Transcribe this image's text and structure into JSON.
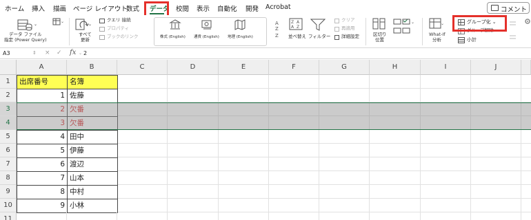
{
  "tabs": [
    "ホーム",
    "挿入",
    "描画",
    "ページ レイアウト",
    "数式",
    "データ",
    "校閲",
    "表示",
    "自動化",
    "開発",
    "Acrobat"
  ],
  "active_tab": "データ",
  "comment_button": "コメント",
  "ribbon": {
    "get_data_line1": "データ ファイル",
    "get_data_line2": "指定 (Power Query)",
    "refresh_line1": "すべて",
    "refresh_line2": "更新",
    "query_connection": "クエリ 接続",
    "properties": "プロパティ",
    "edit_links": "ブックのリンク",
    "stocks": "株式 (English)",
    "currencies": "通貨 (English)",
    "geography": "地理 (English)",
    "sort": "並べ替え",
    "filter": "フィルター",
    "clear": "クリア",
    "reapply": "再適用",
    "advanced": "詳細設定",
    "text_to_columns_line1": "区切り",
    "text_to_columns_line2": "位置",
    "what_if_line1": "What-If",
    "what_if_line2": "分析",
    "group": "グループ化 ⌄",
    "ungroup": "グループ解除",
    "subtotal": "小計"
  },
  "formula_bar": {
    "name_box": "A3",
    "fx": "fx",
    "value": "2"
  },
  "columns": [
    "A",
    "B",
    "C",
    "D",
    "E",
    "F",
    "G",
    "H",
    "I",
    "J"
  ],
  "rows": [
    "1",
    "2",
    "3",
    "4",
    "5",
    "6",
    "7",
    "8",
    "9",
    "10",
    "11"
  ],
  "table": {
    "header_a": "出席番号",
    "header_b": "名簿",
    "data": [
      {
        "num": "1",
        "name": "佐藤"
      },
      {
        "num": "2",
        "name": "欠番"
      },
      {
        "num": "3",
        "name": "欠番"
      },
      {
        "num": "4",
        "name": "田中"
      },
      {
        "num": "5",
        "name": "伊藤"
      },
      {
        "num": "6",
        "name": "渡辺"
      },
      {
        "num": "7",
        "name": "山本"
      },
      {
        "num": "8",
        "name": "中村"
      },
      {
        "num": "9",
        "name": "小林"
      }
    ]
  },
  "colors": {
    "accent": "#217346",
    "highlight_box": "#e4302a",
    "header_fill": "#ffff55",
    "missing_text": "#d9292a"
  }
}
